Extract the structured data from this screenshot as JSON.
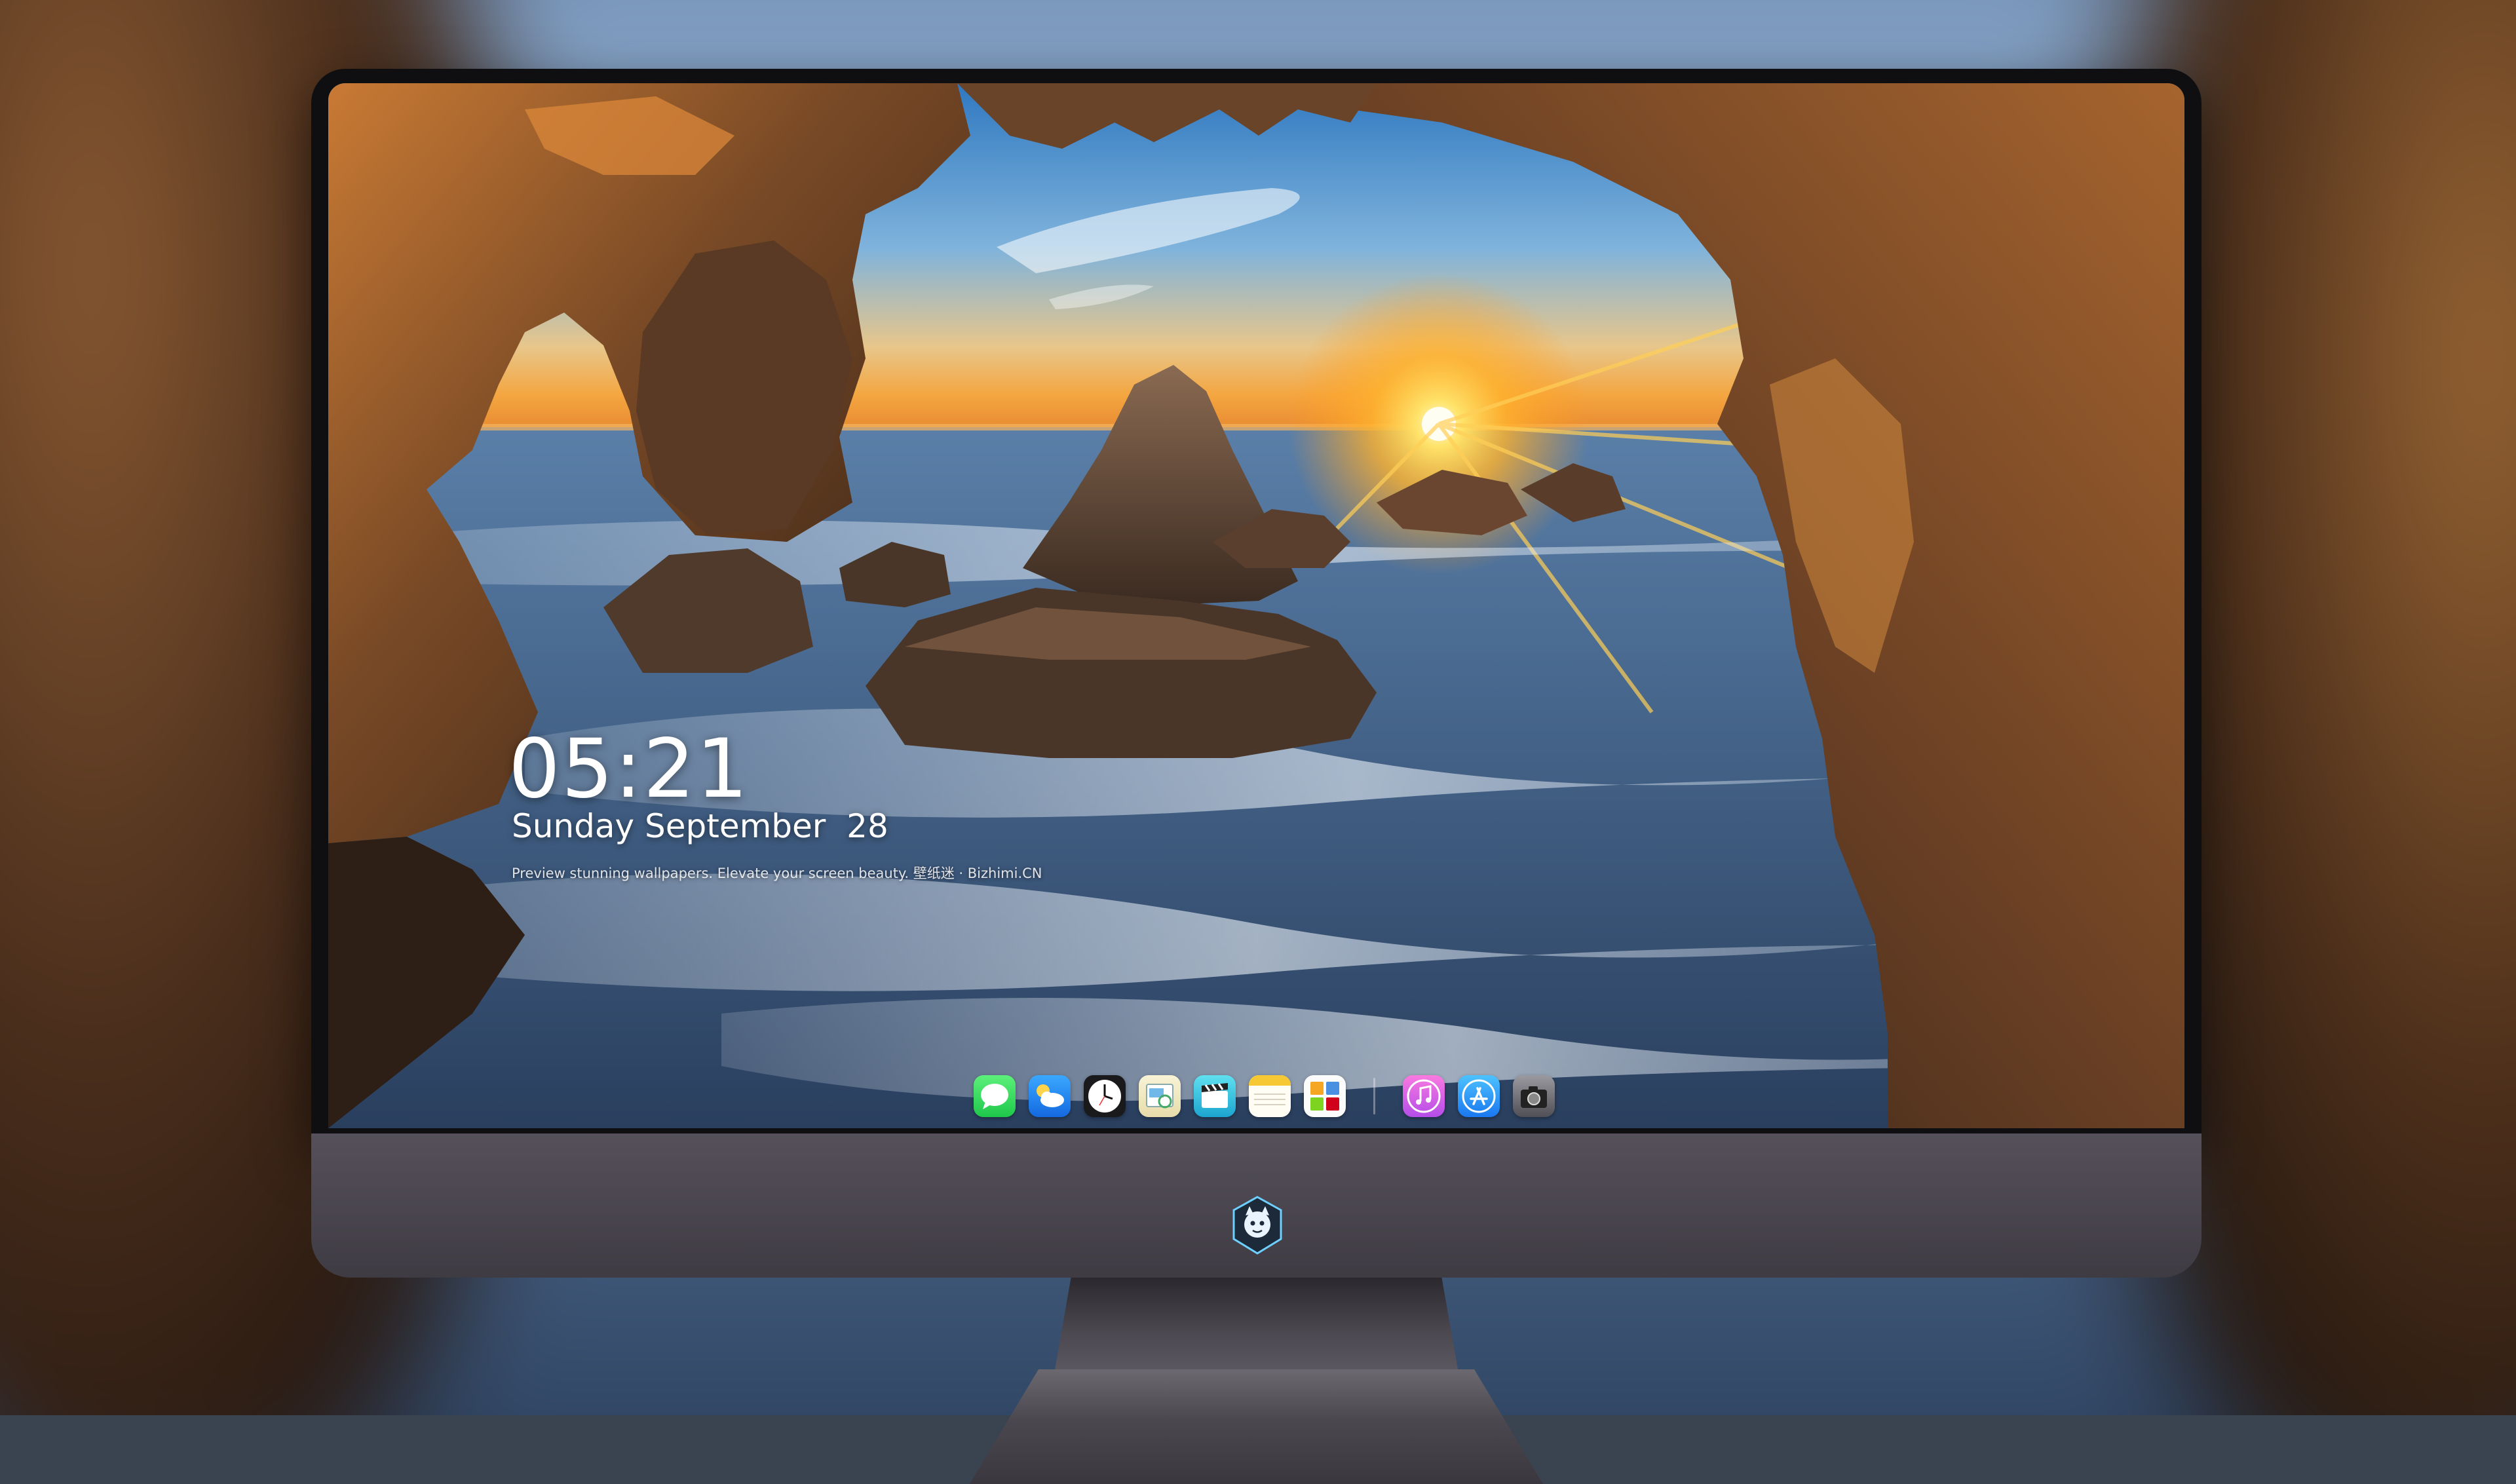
{
  "lock_screen": {
    "time": "05:21",
    "date": "Sunday September  28",
    "tagline": "Preview stunning wallpapers. Elevate your screen beauty. 壁纸迷 · Bizhimi.CN"
  },
  "dock": {
    "apps": [
      {
        "name": "Messages",
        "icon": "message-bubble-icon"
      },
      {
        "name": "Weather",
        "icon": "cloud-sun-icon"
      },
      {
        "name": "Clock",
        "icon": "clock-icon"
      },
      {
        "name": "Preview",
        "icon": "preview-icon"
      },
      {
        "name": "Clips",
        "icon": "clapperboard-icon"
      },
      {
        "name": "Notes",
        "icon": "notes-icon"
      },
      {
        "name": "Photos Mosaic",
        "icon": "mosaic-icon"
      },
      {
        "name": "iTunes",
        "icon": "music-note-icon"
      },
      {
        "name": "App Store",
        "icon": "app-store-icon"
      },
      {
        "name": "Camera",
        "icon": "camera-icon"
      }
    ]
  },
  "monitor": {
    "logo": "mascot-logo-icon"
  },
  "colors": {
    "bezel": "#0f0f12",
    "chin": "#4a464e",
    "sky_top": "#3f86c9",
    "sun": "#ffd24a"
  }
}
